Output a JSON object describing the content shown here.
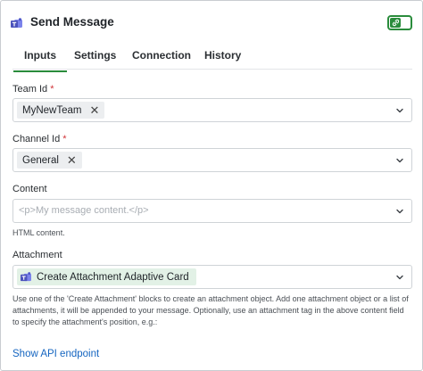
{
  "header": {
    "title": "Send Message",
    "app_icon": "teams-icon",
    "toggle_icon": "link-icon",
    "toggle_enabled": true
  },
  "tabs": [
    {
      "label": "Inputs",
      "active": true
    },
    {
      "label": "Settings",
      "active": false
    },
    {
      "label": "Connection",
      "active": false
    },
    {
      "label": "History",
      "active": false
    }
  ],
  "fields": {
    "team_id": {
      "label": "Team Id",
      "required_mark": "*",
      "chip": "MyNewTeam"
    },
    "channel_id": {
      "label": "Channel Id",
      "required_mark": "*",
      "chip": "General"
    },
    "content": {
      "label": "Content",
      "placeholder": "<p>My message content.</p>",
      "help": "HTML content."
    },
    "attachment": {
      "label": "Attachment",
      "chip": "Create Attachment Adaptive Card",
      "help_lines": [
        "Use one of the 'Create Attachment' blocks to create an attachment object. Add one attachment object or a list of",
        "attachments, it will be appended to your message. Optionally, use an attachment tag in the above content field",
        "to specify the attachment's position, e.g.:"
      ]
    }
  },
  "footer": {
    "api_link": "Show API endpoint"
  },
  "colors": {
    "accent": "#2a8c3c",
    "link": "#1565c0",
    "required": "#d13438"
  }
}
